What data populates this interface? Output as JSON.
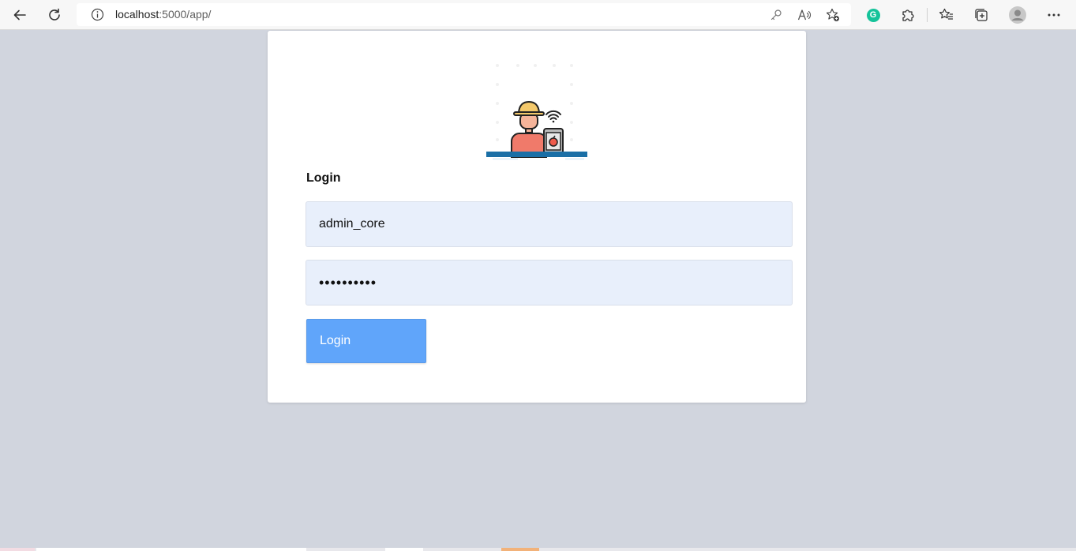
{
  "browser": {
    "url_host": "localhost",
    "url_rest": ":5000/app/",
    "icons": {
      "back": "back-arrow-icon",
      "reload": "reload-icon",
      "info": "info-icon",
      "key": "key-icon",
      "read_aloud": "read-aloud-icon",
      "favorite_add": "add-favorite-icon",
      "grammarly": "grammarly-icon",
      "extensions": "extensions-icon",
      "favorites": "favorites-icon",
      "collections": "collections-icon",
      "profile": "profile-icon",
      "menu": "more-menu-icon"
    },
    "grammarly_letter": "G"
  },
  "login": {
    "title": "Login",
    "username_value": "admin_core",
    "password_value": "••••••••••",
    "button_label": "Login",
    "colors": {
      "button": "#60a5fa",
      "field_bg": "#e8effb",
      "banner": "#1a6fa6",
      "page_bg": "#d1d5de"
    }
  }
}
